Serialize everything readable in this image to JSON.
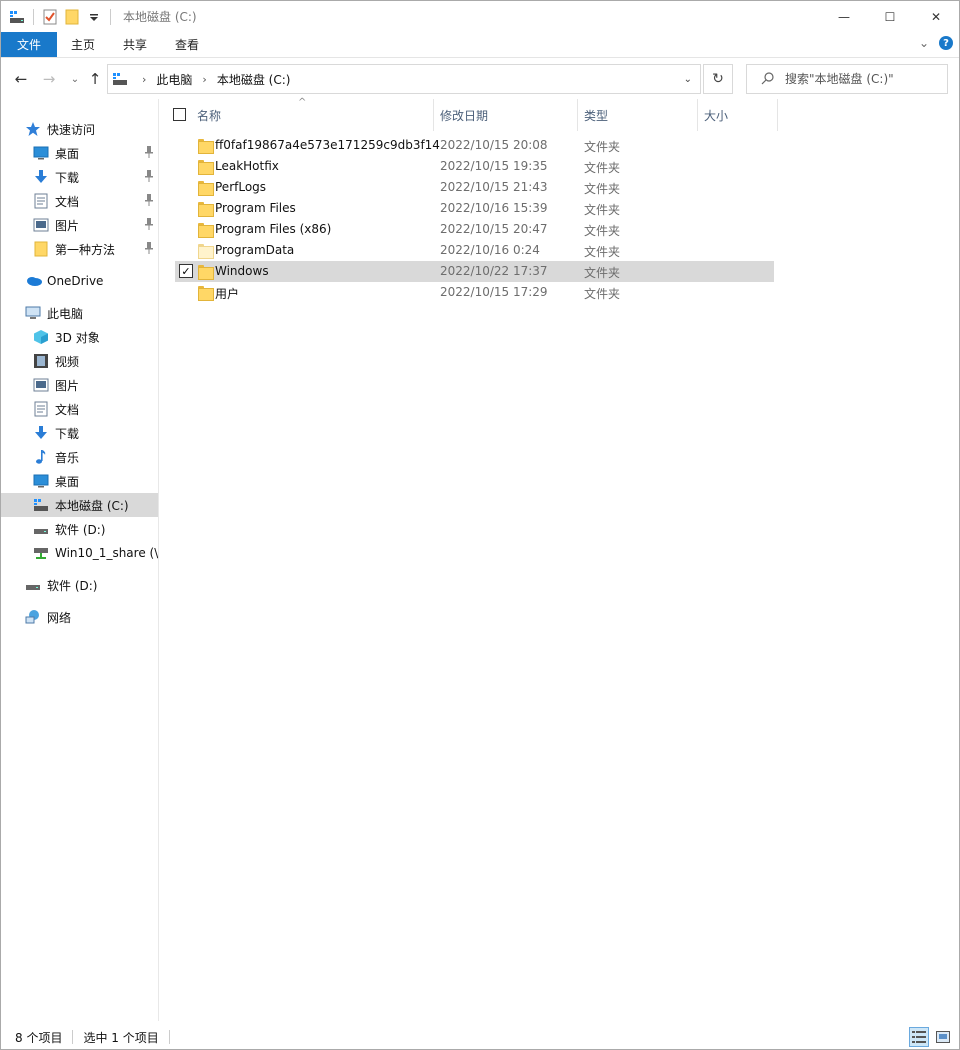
{
  "window": {
    "title": "本地磁盘 (C:)",
    "controls": {
      "minimize": "—",
      "maximize": "☐",
      "close": "✕"
    }
  },
  "ribbon": {
    "tabs": [
      "文件",
      "主页",
      "共享",
      "查看"
    ],
    "expand_glyph": "⌄",
    "help_glyph": "?"
  },
  "nav": {
    "back": "←",
    "forward": "→",
    "recent": "⌄",
    "up": "↑"
  },
  "address": {
    "crumbs": [
      "此电脑",
      "本地磁盘 (C:)"
    ],
    "separator": "›",
    "dropdown": "⌄",
    "refresh": "↻"
  },
  "search": {
    "placeholder": "搜索\"本地磁盘 (C:)\""
  },
  "sidebar": {
    "items": [
      {
        "label": "快速访问",
        "icon": "star-icon",
        "pinned": false,
        "level": 0
      },
      {
        "label": "桌面",
        "icon": "desktop-icon",
        "pinned": true,
        "level": 1
      },
      {
        "label": "下载",
        "icon": "download-icon",
        "pinned": true,
        "level": 1
      },
      {
        "label": "文档",
        "icon": "document-icon",
        "pinned": true,
        "level": 1
      },
      {
        "label": "图片",
        "icon": "pictures-icon",
        "pinned": true,
        "level": 1
      },
      {
        "label": "第一种方法",
        "icon": "folder-icon",
        "pinned": true,
        "level": 1
      },
      {
        "label": "OneDrive",
        "icon": "cloud-icon",
        "pinned": false,
        "level": 0
      },
      {
        "label": "此电脑",
        "icon": "computer-icon",
        "pinned": false,
        "level": 0
      },
      {
        "label": "3D 对象",
        "icon": "cube-icon",
        "pinned": false,
        "level": 1
      },
      {
        "label": "视频",
        "icon": "video-icon",
        "pinned": false,
        "level": 1
      },
      {
        "label": "图片",
        "icon": "pictures-icon",
        "pinned": false,
        "level": 1
      },
      {
        "label": "文档",
        "icon": "document-icon",
        "pinned": false,
        "level": 1
      },
      {
        "label": "下载",
        "icon": "download-icon",
        "pinned": false,
        "level": 1
      },
      {
        "label": "音乐",
        "icon": "music-icon",
        "pinned": false,
        "level": 1
      },
      {
        "label": "桌面",
        "icon": "desktop-icon",
        "pinned": false,
        "level": 1
      },
      {
        "label": "本地磁盘 (C:)",
        "icon": "system-drive-icon",
        "pinned": false,
        "level": 1,
        "selected": true
      },
      {
        "label": "软件 (D:)",
        "icon": "drive-icon",
        "pinned": false,
        "level": 1
      },
      {
        "label": "Win10_1_share (\\\\",
        "icon": "network-drive-icon",
        "pinned": false,
        "level": 1
      },
      {
        "label": "软件 (D:)",
        "icon": "drive-icon",
        "pinned": false,
        "level": 0
      },
      {
        "label": "网络",
        "icon": "network-icon",
        "pinned": false,
        "level": 0
      }
    ],
    "pin_glyph": "📌"
  },
  "columns": {
    "name": "名称",
    "modified": "修改日期",
    "type": "类型",
    "size": "大小",
    "sort_glyph": "^"
  },
  "files": [
    {
      "name": "ff0faf19867a4e573e171259c9db3f14",
      "modified": "2022/10/15 20:08",
      "type": "文件夹",
      "selected": false,
      "faded": false
    },
    {
      "name": "LeakHotfix",
      "modified": "2022/10/15 19:35",
      "type": "文件夹",
      "selected": false,
      "faded": false
    },
    {
      "name": "PerfLogs",
      "modified": "2022/10/15 21:43",
      "type": "文件夹",
      "selected": false,
      "faded": false
    },
    {
      "name": "Program Files",
      "modified": "2022/10/16 15:39",
      "type": "文件夹",
      "selected": false,
      "faded": false
    },
    {
      "name": "Program Files (x86)",
      "modified": "2022/10/15 20:47",
      "type": "文件夹",
      "selected": false,
      "faded": false
    },
    {
      "name": "ProgramData",
      "modified": "2022/10/16 0:24",
      "type": "文件夹",
      "selected": false,
      "faded": true
    },
    {
      "name": "Windows",
      "modified": "2022/10/22 17:37",
      "type": "文件夹",
      "selected": true,
      "faded": false
    },
    {
      "name": "用户",
      "modified": "2022/10/15 17:29",
      "type": "文件夹",
      "selected": false,
      "faded": false
    }
  ],
  "checkmark": "✓",
  "status": {
    "count": "8 个项目",
    "selection": "选中 1 个项目"
  },
  "colors": {
    "accent": "#1979ca",
    "selection": "#d9d9d9",
    "header_text": "#4c607a",
    "folder": "#ffd766"
  }
}
